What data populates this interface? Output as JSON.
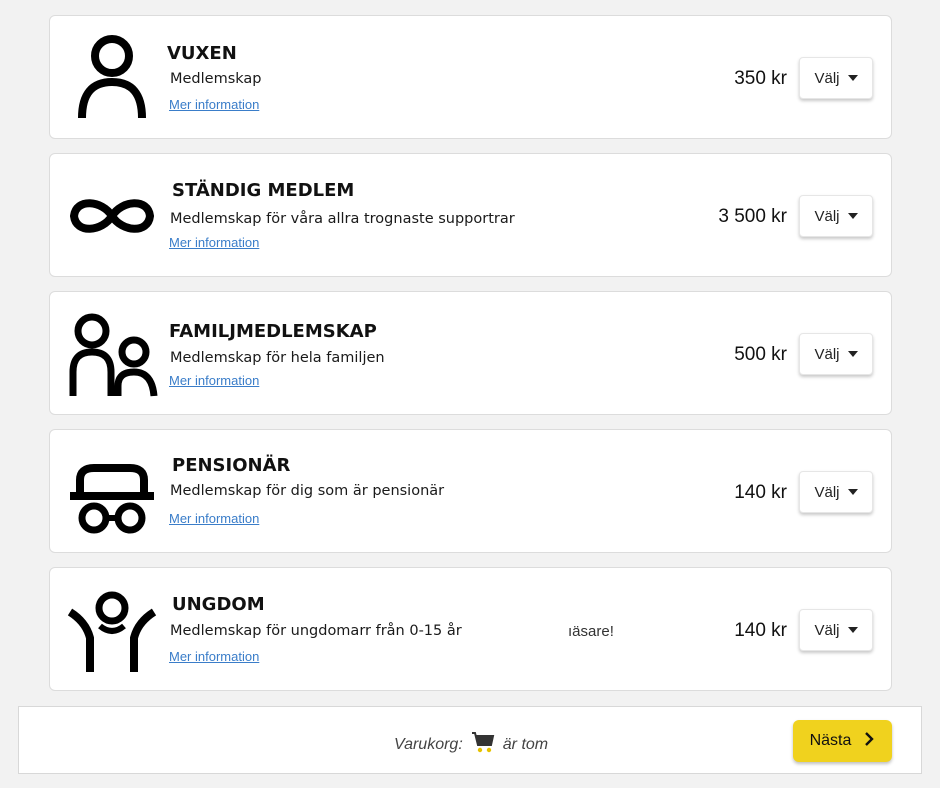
{
  "memberships": [
    {
      "title": "VUXEN",
      "description": "Medlemskap",
      "more": "Mer information",
      "price": "350 kr",
      "select": "Välj",
      "icon": "person-icon"
    },
    {
      "title": "STÄNDIG MEDLEM",
      "description": "Medlemskap för våra allra trognaste supportrar",
      "more": "Mer information",
      "price": "3 500 kr",
      "select": "Välj",
      "icon": "infinity-icon"
    },
    {
      "title": "FAMILJMEDLEMSKAP",
      "description": "Medlemskap för hela familjen",
      "more": "Mer information",
      "price": "500 kr",
      "select": "Välj",
      "icon": "family-icon"
    },
    {
      "title": "PENSIONÄR",
      "description": "Medlemskap för dig som är pensionär",
      "more": "Mer information",
      "price": "140 kr",
      "select": "Välj",
      "icon": "senior-icon"
    },
    {
      "title": "UNGDOM",
      "description": "Medlemskap för ungdomarr från 0-15 år",
      "more": "Mer information",
      "price": "140 kr",
      "select": "Välj",
      "icon": "youth-icon"
    }
  ],
  "overlay_fragment": "ıäsare!",
  "cart": {
    "label": "Varukorg:",
    "status": "är tom",
    "icon": "cart-icon"
  },
  "next_button": {
    "label": "Nästa",
    "icon": "chevron-right-icon"
  },
  "colors": {
    "accent": "#f0d21e",
    "link": "#3a7dc9",
    "cart_wheels": "#e6c200"
  }
}
